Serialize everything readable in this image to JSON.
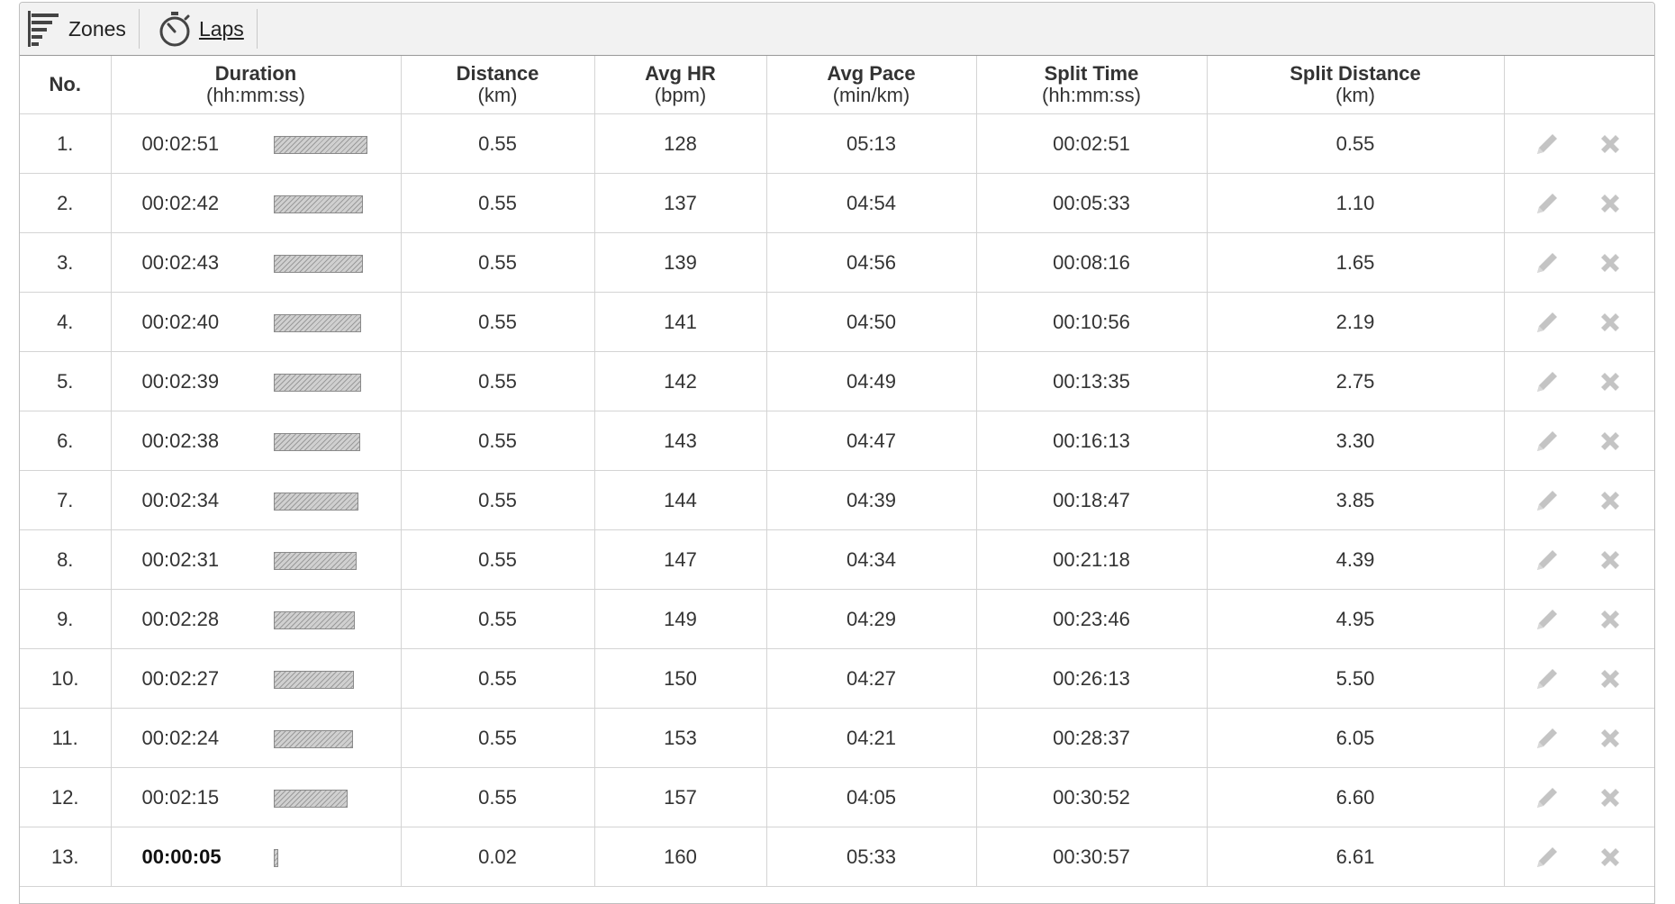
{
  "toolbar": {
    "zones_label": "Zones",
    "laps_label": "Laps"
  },
  "columns": {
    "no": {
      "title": "No.",
      "unit": ""
    },
    "duration": {
      "title": "Duration",
      "unit": "(hh:mm:ss)"
    },
    "distance": {
      "title": "Distance",
      "unit": "(km)"
    },
    "avg_hr": {
      "title": "Avg HR",
      "unit": "(bpm)"
    },
    "avg_pace": {
      "title": "Avg Pace",
      "unit": "(min/km)"
    },
    "split_time": {
      "title": "Split Time",
      "unit": "(hh:mm:ss)"
    },
    "split_distance": {
      "title": "Split Distance",
      "unit": "(km)"
    }
  },
  "max_duration_seconds": 171,
  "rows": [
    {
      "no": "1.",
      "duration": "00:02:51",
      "duration_seconds": 171,
      "distance": "0.55",
      "avg_hr": "128",
      "avg_pace": "05:13",
      "split_time": "00:02:51",
      "split_distance": "0.55"
    },
    {
      "no": "2.",
      "duration": "00:02:42",
      "duration_seconds": 162,
      "distance": "0.55",
      "avg_hr": "137",
      "avg_pace": "04:54",
      "split_time": "00:05:33",
      "split_distance": "1.10"
    },
    {
      "no": "3.",
      "duration": "00:02:43",
      "duration_seconds": 163,
      "distance": "0.55",
      "avg_hr": "139",
      "avg_pace": "04:56",
      "split_time": "00:08:16",
      "split_distance": "1.65"
    },
    {
      "no": "4.",
      "duration": "00:02:40",
      "duration_seconds": 160,
      "distance": "0.55",
      "avg_hr": "141",
      "avg_pace": "04:50",
      "split_time": "00:10:56",
      "split_distance": "2.19"
    },
    {
      "no": "5.",
      "duration": "00:02:39",
      "duration_seconds": 159,
      "distance": "0.55",
      "avg_hr": "142",
      "avg_pace": "04:49",
      "split_time": "00:13:35",
      "split_distance": "2.75"
    },
    {
      "no": "6.",
      "duration": "00:02:38",
      "duration_seconds": 158,
      "distance": "0.55",
      "avg_hr": "143",
      "avg_pace": "04:47",
      "split_time": "00:16:13",
      "split_distance": "3.30"
    },
    {
      "no": "7.",
      "duration": "00:02:34",
      "duration_seconds": 154,
      "distance": "0.55",
      "avg_hr": "144",
      "avg_pace": "04:39",
      "split_time": "00:18:47",
      "split_distance": "3.85"
    },
    {
      "no": "8.",
      "duration": "00:02:31",
      "duration_seconds": 151,
      "distance": "0.55",
      "avg_hr": "147",
      "avg_pace": "04:34",
      "split_time": "00:21:18",
      "split_distance": "4.39"
    },
    {
      "no": "9.",
      "duration": "00:02:28",
      "duration_seconds": 148,
      "distance": "0.55",
      "avg_hr": "149",
      "avg_pace": "04:29",
      "split_time": "00:23:46",
      "split_distance": "4.95"
    },
    {
      "no": "10.",
      "duration": "00:02:27",
      "duration_seconds": 147,
      "distance": "0.55",
      "avg_hr": "150",
      "avg_pace": "04:27",
      "split_time": "00:26:13",
      "split_distance": "5.50"
    },
    {
      "no": "11.",
      "duration": "00:02:24",
      "duration_seconds": 144,
      "distance": "0.55",
      "avg_hr": "153",
      "avg_pace": "04:21",
      "split_time": "00:28:37",
      "split_distance": "6.05"
    },
    {
      "no": "12.",
      "duration": "00:02:15",
      "duration_seconds": 135,
      "distance": "0.55",
      "avg_hr": "157",
      "avg_pace": "04:05",
      "split_time": "00:30:52",
      "split_distance": "6.60"
    },
    {
      "no": "13.",
      "duration": "00:00:05",
      "duration_seconds": 5,
      "distance": "0.02",
      "avg_hr": "160",
      "avg_pace": "05:33",
      "split_time": "00:30:57",
      "split_distance": "6.61",
      "emphasis": true
    }
  ],
  "icons": {
    "zones": "zones-bars-icon",
    "laps": "stopwatch-icon",
    "edit": "pencil-icon",
    "delete": "close-x-icon"
  },
  "colors": {
    "toolbar_bg": "#f2f2f2",
    "grid_line": "#d4d4d4",
    "bar_fill": "#d0d0d0",
    "icon_gray": "#c4c4c4"
  }
}
